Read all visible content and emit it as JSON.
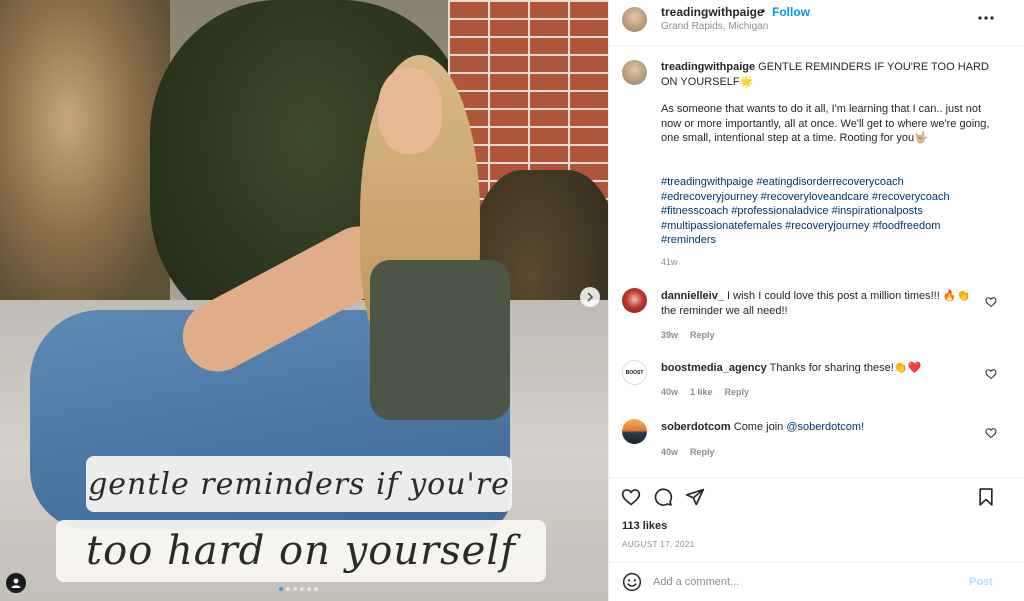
{
  "post": {
    "username": "treadingwithpaige",
    "separator": "•",
    "follow_label": "Follow",
    "location": "Grand Rapids, Michigan",
    "photo_text_line1": "gentle reminders if you're",
    "photo_text_line2": "too hard on yourself",
    "slide_count": 6,
    "active_slide": 1
  },
  "caption": {
    "username": "treadingwithpaige",
    "headline": " GENTLE REMINDERS IF YOU'RE TOO HARD ON YOURSELF🌟",
    "body": "As someone that wants to do it all, I'm learning that I can.. just not now or more importantly, all at once. We'll get to where we're going, one small, intentional step at a time. Rooting for you🤟🏼",
    "hashtags": "#treadingwithpaige #eatingdisorderrecoverycoach #edrecoveryjourney #recoveryloveandcare #recoverycoach #fitnesscoach #professionaladvice #inspirationalposts #multipassionatefemales #recoveryjourney #foodfreedom #reminders",
    "time": "41w"
  },
  "comments": [
    {
      "username": "dannielleiv_",
      "text": " I wish I could love this post a million times!!! 🔥👏 the reminder we all need!!",
      "time": "39w",
      "likes": "",
      "reply_label": "Reply"
    },
    {
      "username": "boostmedia_agency",
      "avatar_text": "BOOST",
      "text": " Thanks for sharing these!👏❤️",
      "time": "40w",
      "likes": "1 like",
      "reply_label": "Reply"
    },
    {
      "username": "soberdotcom",
      "text": " Come join ",
      "mention": "@soberdotcom!",
      "time": "40w",
      "likes": "",
      "reply_label": "Reply"
    }
  ],
  "engagement": {
    "likes": "113 likes",
    "date": "AUGUST 17, 2021"
  },
  "add_comment": {
    "placeholder": "Add a comment...",
    "post_label": "Post"
  },
  "colors": {
    "link_blue": "#0095f6",
    "hashtag_blue": "#00376b",
    "muted_text": "#8e8e8e",
    "post_disabled": "#b2dffc"
  },
  "icons": {
    "more": "more-horizontal-icon",
    "heart": "heart-icon",
    "comment": "comment-icon",
    "share": "send-icon",
    "save": "bookmark-icon",
    "emoji": "emoji-icon",
    "next": "chevron-right-icon",
    "tag": "user-tag-icon"
  }
}
